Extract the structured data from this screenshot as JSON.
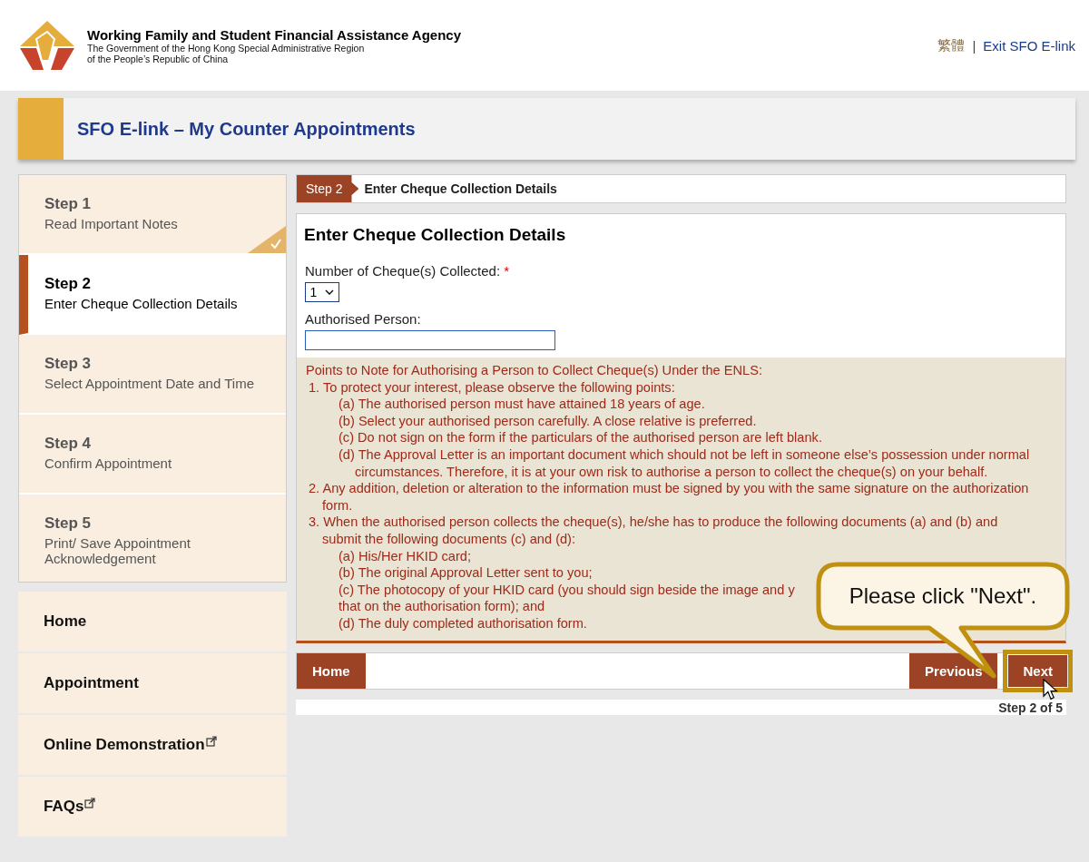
{
  "header": {
    "agency": "Working Family and Student Financial Assistance Agency",
    "government_line_1": "The Government of the Hong Kong Special Administrative Region",
    "government_line_2": "of the People’s Republic of China",
    "language": "繁體",
    "separator": "|",
    "exit_link": "Exit SFO E-link"
  },
  "page_title": "SFO E-link – My Counter Appointments",
  "steps": [
    {
      "label": "Step 1",
      "description": "Read Important Notes",
      "completed": true,
      "selected": false
    },
    {
      "label": "Step 2",
      "description": "Enter Cheque Collection Details",
      "completed": false,
      "selected": true
    },
    {
      "label": "Step 3",
      "description": "Select Appointment Date and Time",
      "completed": false,
      "selected": false
    },
    {
      "label": "Step 4",
      "description": "Confirm Appointment",
      "completed": false,
      "selected": false
    },
    {
      "label": "Step 5",
      "description": "Print/ Save Appointment Acknowledgement",
      "completed": false,
      "selected": false
    }
  ],
  "nav": [
    {
      "label": "Home",
      "external": false
    },
    {
      "label": "Appointment",
      "external": false
    },
    {
      "label": "Online Demonstration",
      "external": true
    },
    {
      "label": "FAQs",
      "external": true
    }
  ],
  "step_bar": {
    "badge": "Step 2",
    "title": "Enter Cheque Collection Details"
  },
  "form": {
    "title": "Enter Cheque Collection Details",
    "cheques_label": "Number of Cheque(s) Collected:",
    "required_mark": "*",
    "cheques_value": "1",
    "person_label": "Authorised Person:"
  },
  "notes": {
    "heading": "Points to Note for Authorising a Person to Collect Cheque(s) Under the ENLS:",
    "items": [
      {
        "text": "1. To protect your interest, please observe the following points:",
        "children": [
          {
            "text": "(a) The authorised person must have attained 18 years of age."
          },
          {
            "text": "(b) Select your authorised person carefully. A close relative is preferred."
          },
          {
            "text": "(c) Do not sign on the form if the particulars of the authorised person are left blank."
          },
          {
            "text": "(d) The Approval Letter is an important document which should not be left in someone else’s possession under normal circumstances. Therefore, it is at your own risk to authorise a person to collect the cheque(s) on your behalf."
          }
        ]
      },
      {
        "text": "2. Any addition, deletion or alteration to the information must be signed by you with the same signature on the authorization form."
      },
      {
        "text": "3. When the authorised person collects the cheque(s), he/she has to produce the following documents (a) and (b) and submit the following documents (c) and (d):",
        "children": [
          {
            "text": "(a) His/Her HKID card;"
          },
          {
            "text": "(b) The original Approval Letter sent to you;"
          },
          {
            "text": "(c) The photocopy of your HKID card (you should sign beside the image and y"
          },
          {
            "text": "that on the authorisation form); and"
          },
          {
            "text": "(d) The duly completed authorisation form."
          }
        ]
      }
    ]
  },
  "buttons": {
    "home": "Home",
    "previous": "Previous",
    "next": "Next"
  },
  "progress": "Step 2 of 5",
  "callout": "Please click \"Next\"."
}
